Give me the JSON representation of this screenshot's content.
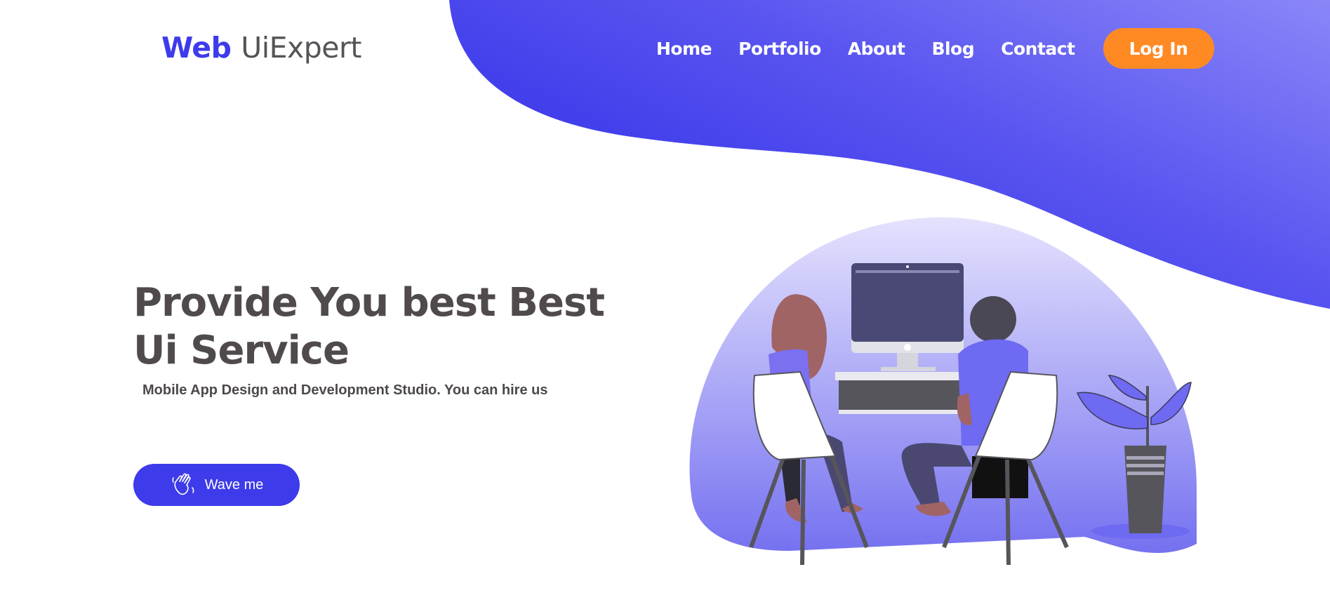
{
  "header": {
    "logo_part1": "Web",
    "logo_part2": "UiExpert",
    "nav": [
      "Home",
      "Portfolio",
      "About",
      "Blog",
      "Contact"
    ],
    "login_label": "Log In"
  },
  "hero": {
    "title": "Provide You best Best Ui Service",
    "subtitle": "Mobile App Design and Development Studio. You can hire us",
    "cta_label": "Wave me",
    "cta_icon": "waving-hand-icon"
  },
  "colors": {
    "brand": "#3d3bea",
    "accent": "#ff8a24",
    "text": "#504a4d"
  }
}
